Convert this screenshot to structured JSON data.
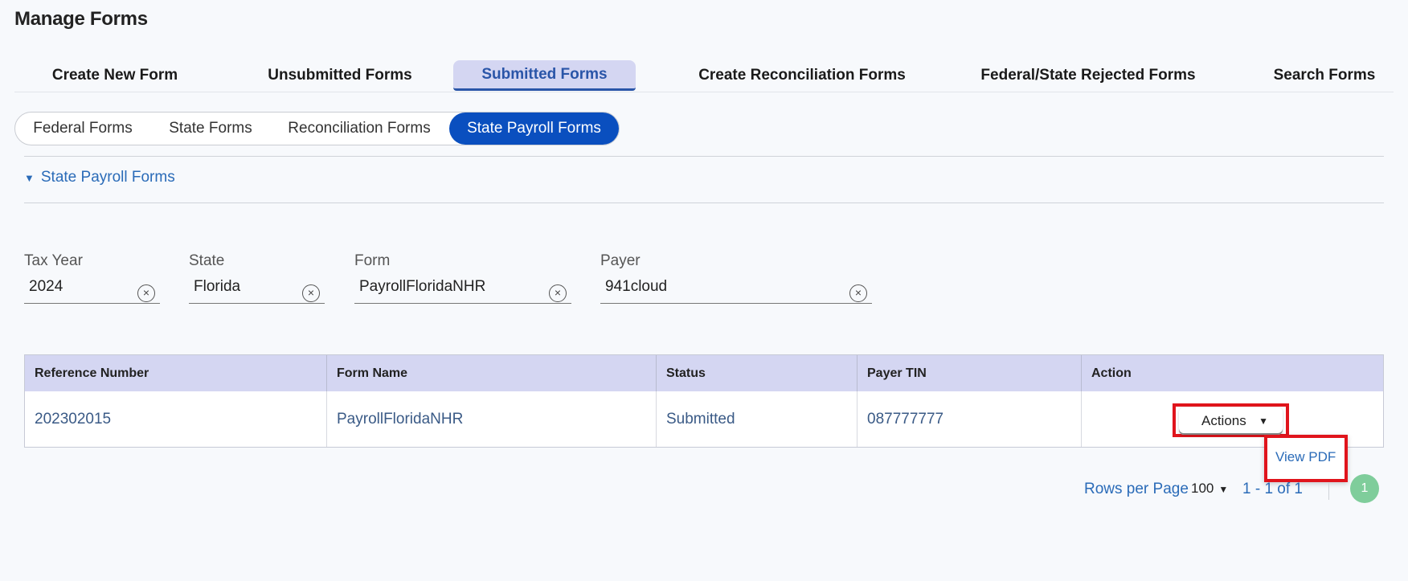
{
  "page": {
    "title": "Manage Forms"
  },
  "main_tabs": [
    {
      "label": "Create New Form"
    },
    {
      "label": "Unsubmitted Forms"
    },
    {
      "label": "Submitted Forms",
      "active": true
    },
    {
      "label": "Create Reconciliation Forms"
    },
    {
      "label": "Federal/State Rejected Forms"
    },
    {
      "label": "Search Forms"
    }
  ],
  "sub_tabs": [
    {
      "label": "Federal Forms"
    },
    {
      "label": "State Forms"
    },
    {
      "label": "Reconciliation Forms"
    },
    {
      "label": "State Payroll Forms",
      "active": true
    }
  ],
  "section": {
    "label": "State Payroll Forms",
    "icon": "caret-down-icon",
    "expanded": true
  },
  "filters": {
    "tax_year": {
      "label": "Tax Year",
      "value": "2024"
    },
    "state": {
      "label": "State",
      "value": "Florida"
    },
    "form": {
      "label": "Form",
      "value": "PayrollFloridaNHR"
    },
    "payer": {
      "label": "Payer",
      "value": "941cloud"
    },
    "clear_icon": "×"
  },
  "table": {
    "headers": [
      "Reference Number",
      "Form Name",
      "Status",
      "Payer TIN",
      "Action"
    ],
    "rows": [
      {
        "reference_number": "202302015",
        "form_name": "PayrollFloridaNHR",
        "status": "Submitted",
        "payer_tin": "087777777",
        "action_label": "Actions"
      }
    ]
  },
  "actions_menu": {
    "arrow": "▼",
    "items": [
      {
        "label": "View PDF"
      }
    ]
  },
  "pagination": {
    "rows_per_page_label": "Rows per Page",
    "rows_per_page_value": "100",
    "range_text": "1 - 1 of 1",
    "current_page": "1"
  },
  "colors": {
    "primary": "#0a4fbf",
    "tab_active_bg": "#d4d6f2",
    "link": "#2a6bb8",
    "highlight_border": "#e0141c",
    "page_badge": "#7fcd9b"
  }
}
